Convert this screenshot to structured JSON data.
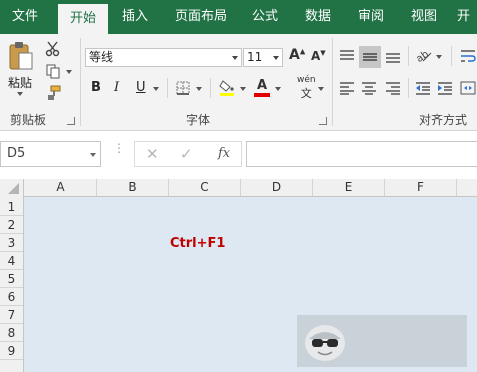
{
  "tabs": [
    {
      "label": "文件",
      "active": false
    },
    {
      "label": "开始",
      "active": true
    },
    {
      "label": "插入",
      "active": false
    },
    {
      "label": "页面布局",
      "active": false
    },
    {
      "label": "公式",
      "active": false
    },
    {
      "label": "数据",
      "active": false
    },
    {
      "label": "审阅",
      "active": false
    },
    {
      "label": "视图",
      "active": false
    },
    {
      "label": "开",
      "active": false
    }
  ],
  "ribbon": {
    "clipboard": {
      "paste_label": "粘贴",
      "group_label": "剪贴板"
    },
    "font": {
      "font_name": "等线",
      "font_size": "11",
      "group_label": "字体",
      "bold": "B",
      "italic": "I",
      "underline": "U",
      "grow": "A",
      "shrink": "A",
      "font_color_letter": "A",
      "phonetic_top": "wén",
      "phonetic_bottom": "文"
    },
    "alignment": {
      "group_label": "对齐方式"
    }
  },
  "formula_bar": {
    "name_box": "D5",
    "fx_label": "fx",
    "formula_value": ""
  },
  "grid": {
    "columns": [
      "A",
      "B",
      "C",
      "D",
      "E",
      "F"
    ],
    "rows": [
      "1",
      "2",
      "3",
      "4",
      "5",
      "6",
      "7",
      "8",
      "9"
    ],
    "cell_text": "Ctrl+F1"
  },
  "colors": {
    "brand": "#217346",
    "ribbon_bg": "#f3f3f3",
    "sheet_bg": "#dde8f2",
    "cell_text": "#c00000",
    "font_color_bar": "#e00000"
  }
}
